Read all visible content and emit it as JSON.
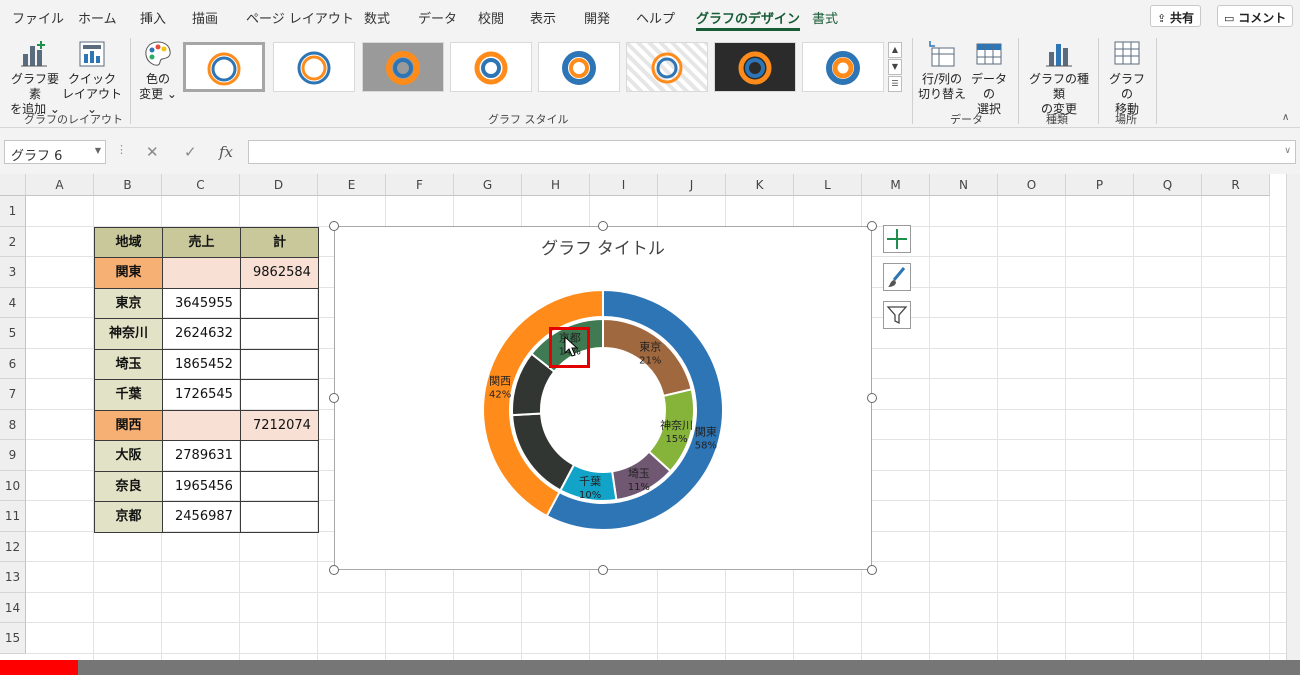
{
  "ribbon_tabs": [
    "ファイル",
    "ホーム",
    "挿入",
    "描画",
    "ページ レイアウト",
    "数式",
    "データ",
    "校閲",
    "表示",
    "開発",
    "ヘルプ",
    "グラフのデザイン",
    "書式"
  ],
  "active_tab": "グラフのデザイン",
  "top_buttons": {
    "share": "共有",
    "comment": "コメント"
  },
  "ribbon": {
    "add_element": [
      "グラフ要素",
      "を追加 ⌄"
    ],
    "quick_layout": [
      "クイック",
      "レイアウト ⌄"
    ],
    "group_layout": "グラフのレイアウト",
    "change_color": [
      "色の",
      "変更 ⌄"
    ],
    "group_styles": "グラフ スタイル",
    "switch_row_col": [
      "行/列の",
      "切り替え"
    ],
    "select_data": [
      "データの",
      "選択"
    ],
    "group_data": "データ",
    "change_type": [
      "グラフの種類",
      "の変更"
    ],
    "group_type": "種類",
    "move_chart": [
      "グラフの",
      "移動"
    ],
    "group_location": "場所"
  },
  "name_box": "グラフ 6",
  "formula_icons": {
    "cancel": "✕",
    "enter": "✓",
    "fx": "fx"
  },
  "columns": [
    "A",
    "B",
    "C",
    "D",
    "E",
    "F",
    "G",
    "H",
    "I",
    "J",
    "K",
    "L",
    "M",
    "N",
    "O",
    "P",
    "Q",
    "R"
  ],
  "rows": [
    "1",
    "2",
    "3",
    "4",
    "5",
    "6",
    "7",
    "8",
    "9",
    "10",
    "11",
    "12",
    "13",
    "14",
    "15"
  ],
  "table": {
    "headers": [
      "地域",
      "売上",
      "計"
    ],
    "rows": [
      {
        "type": "region",
        "area": "関東",
        "sales": "",
        "total": "9862584"
      },
      {
        "type": "item",
        "area": "東京",
        "sales": "3645955",
        "total": ""
      },
      {
        "type": "item",
        "area": "神奈川",
        "sales": "2624632",
        "total": ""
      },
      {
        "type": "item",
        "area": "埼玉",
        "sales": "1865452",
        "total": ""
      },
      {
        "type": "item",
        "area": "千葉",
        "sales": "1726545",
        "total": ""
      },
      {
        "type": "region",
        "area": "関西",
        "sales": "",
        "total": "7212074"
      },
      {
        "type": "item",
        "area": "大阪",
        "sales": "2789631",
        "total": ""
      },
      {
        "type": "item",
        "area": "奈良",
        "sales": "1965456",
        "total": ""
      },
      {
        "type": "item",
        "area": "京都",
        "sales": "2456987",
        "total": ""
      }
    ]
  },
  "chart_data": {
    "type": "doughnut",
    "title": "グラフ タイトル",
    "outer": {
      "labels": [
        "関東",
        "関西"
      ],
      "values": [
        9862584,
        7212074
      ],
      "percent_labels": [
        "58%",
        "42%"
      ],
      "colors": [
        "#2e75b6",
        "#ff8c1a"
      ]
    },
    "inner": {
      "labels": [
        "東京",
        "神奈川",
        "埼玉",
        "千葉",
        "大阪",
        "奈良",
        "京都"
      ],
      "values": [
        3645955,
        2624632,
        1865452,
        1726545,
        2789631,
        1965456,
        2456987
      ],
      "percent_labels": [
        "21%",
        "15%",
        "11%",
        "10%",
        "",
        "",
        "14%"
      ],
      "colors": [
        "#a0683f",
        "#86b43a",
        "#705873",
        "#12a3c8",
        "#313633",
        "#313633",
        "#3f7a52"
      ]
    }
  },
  "colors": {
    "selection_highlight": "#e30000",
    "excel_green": "#185c37"
  }
}
